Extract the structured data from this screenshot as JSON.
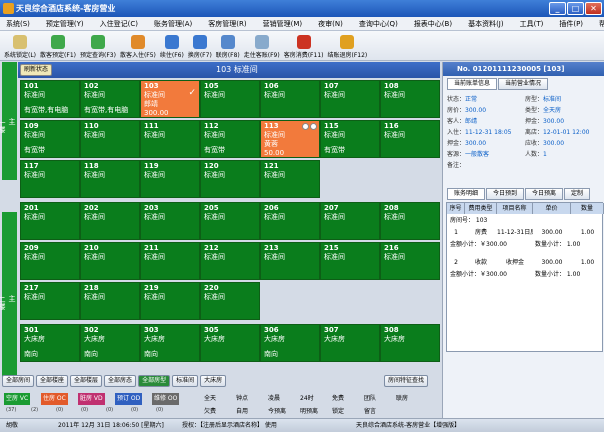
{
  "window": {
    "title": "天良综合酒店系统-客房营业"
  },
  "menu": [
    "系统(S)",
    "预定管理(Y)",
    "入住登记(C)",
    "账务管理(A)",
    "客房管理(R)",
    "营销管理(M)",
    "查询中心(Q)",
    "报表中心(B)",
    "基本资料(J)",
    "工具(T)",
    "插件(P)",
    "帮助(H)"
  ],
  "menu_short": "夜审(N)",
  "toolbar": [
    "系统锁定(L)",
    "散客预定(F1)",
    "预定查询(F3)",
    "散客入住(F5)",
    "续住(F6)",
    "换房(F7)",
    "联房(F8)",
    "走住客账(F9)",
    "客房消费(F11)",
    "结账退房(F12)"
  ],
  "roomhead": {
    "refresh": "刷新状态",
    "title": "103 标准间"
  },
  "floors": [
    "一楼",
    "二楼"
  ],
  "floor_tab": "主",
  "rooms": [
    {
      "n": "101",
      "t": "标准间",
      "s": "有宽带,有电脑"
    },
    {
      "n": "102",
      "t": "标准间",
      "s": "有宽带,有电脑"
    },
    {
      "n": "103",
      "t": "标准间",
      "g": "郎靖",
      "p": "300.00",
      "occ": true
    },
    {
      "n": "105",
      "t": "标准间"
    },
    {
      "n": "106",
      "t": "标准间"
    },
    {
      "n": "107",
      "t": "标准间"
    },
    {
      "n": "108",
      "t": "标准间"
    },
    {
      "n": "109",
      "t": "标准间",
      "s": "有宽带"
    },
    {
      "n": "110",
      "t": "标准间"
    },
    {
      "n": "111",
      "t": "标准间"
    },
    {
      "n": "112",
      "t": "标准间",
      "s": "有宽带"
    },
    {
      "n": "113",
      "t": "标准间",
      "g": "黄蓉",
      "p": "50.00",
      "occ": true
    },
    {
      "n": "115",
      "t": "标准间",
      "s": "有宽带"
    },
    {
      "n": "116",
      "t": "标准间"
    },
    {
      "n": "117",
      "t": "标准间"
    },
    {
      "n": "118",
      "t": "标准间"
    },
    {
      "n": "119",
      "t": "标准间"
    },
    {
      "n": "120",
      "t": "标准间"
    },
    {
      "n": "121",
      "t": "标准间"
    },
    {
      "n": "201",
      "t": "标准间"
    },
    {
      "n": "202",
      "t": "标准间"
    },
    {
      "n": "203",
      "t": "标准间"
    },
    {
      "n": "205",
      "t": "标准间"
    },
    {
      "n": "206",
      "t": "标准间"
    },
    {
      "n": "207",
      "t": "标准间"
    },
    {
      "n": "208",
      "t": "标准间"
    },
    {
      "n": "209",
      "t": "标准间"
    },
    {
      "n": "210",
      "t": "标准间"
    },
    {
      "n": "211",
      "t": "标准间"
    },
    {
      "n": "212",
      "t": "标准间"
    },
    {
      "n": "213",
      "t": "标准间"
    },
    {
      "n": "215",
      "t": "标准间"
    },
    {
      "n": "216",
      "t": "标准间"
    },
    {
      "n": "217",
      "t": "标准间"
    },
    {
      "n": "218",
      "t": "标准间"
    },
    {
      "n": "219",
      "t": "标准间"
    },
    {
      "n": "220",
      "t": "标准间"
    },
    {
      "n": "301",
      "t": "大床房",
      "s": "南向"
    },
    {
      "n": "302",
      "t": "大床房",
      "s": "南向"
    },
    {
      "n": "303",
      "t": "大床房",
      "s": "南向"
    },
    {
      "n": "305",
      "t": "大床房"
    },
    {
      "n": "306",
      "t": "大床房",
      "s": "南向"
    },
    {
      "n": "307",
      "t": "大床房"
    },
    {
      "n": "308",
      "t": "大床房"
    }
  ],
  "filters": [
    "全部房间",
    "全部楼座",
    "全部楼层",
    "全部房态",
    "全部房型",
    "标准间",
    "大床房"
  ],
  "roomsearch": "房间特征查找",
  "legend_colors": [
    "空房 VC",
    "住房 OC",
    "脏房 VD",
    "预订 OD",
    "维修 OO"
  ],
  "legend_counts": [
    "(37)",
    "(2)",
    "(0)",
    "(0)",
    "(0)",
    "(0)",
    "(0)"
  ],
  "legend_marks": [
    "全天",
    "钟点",
    "凌晨",
    "24时",
    "免费",
    "团队",
    "联房",
    "欠费",
    "自用",
    "今预离",
    "明预离",
    "锁定",
    "留言"
  ],
  "panel": {
    "no": "No. 01201111230005 [103]",
    "tabs1": [
      "当前账单信息",
      "当前营业情况"
    ],
    "fields": [
      [
        "状态：",
        "正常"
      ],
      [
        "房型：",
        "标准间"
      ],
      [
        "房价：",
        "300.00"
      ],
      [
        "类型：",
        "全天房"
      ],
      [
        "客人：",
        "郎靖"
      ],
      [
        "押金：",
        "300.00"
      ],
      [
        "入住：",
        "11-12-31 18:05"
      ],
      [
        "离店：",
        "12-01-01 12:00"
      ],
      [
        "押金：",
        "300.00"
      ],
      [
        "应收：",
        "300.00"
      ],
      [
        "客源：",
        "一般散客"
      ],
      [
        "人数：",
        "1"
      ],
      [
        "备注：",
        ""
      ]
    ],
    "tabs2": [
      "账务明细",
      "今日预到",
      "今日预离",
      "定制"
    ],
    "bill_head": [
      "序号",
      "费用类型",
      "项目名称",
      "单价",
      "数量"
    ],
    "bill_room": "房间号： 103",
    "bill_rows": [
      [
        "1",
        "房费",
        "11-12-31日房",
        "300.00",
        "1.00"
      ],
      [
        "2",
        "收款",
        "收押金",
        "300.00",
        "1.00"
      ]
    ],
    "bill_sub": [
      [
        "金额小计：￥300.00",
        "数量小计： 1.00"
      ],
      [
        "金额小计：￥300.00",
        "数量小计： 1.00"
      ]
    ]
  },
  "status": {
    "user": "胡敬",
    "date": "2011年 12月 31日 18:06:50 [星期六]",
    "license": "授权：【注册后显示酒店名称】 使用",
    "app": "天良综合酒店系统-客房营业【增强版】"
  },
  "colors": {
    "vacant": "#0a7d1c",
    "occupied": "#f27a3c",
    "accent": "#2a54a8"
  }
}
